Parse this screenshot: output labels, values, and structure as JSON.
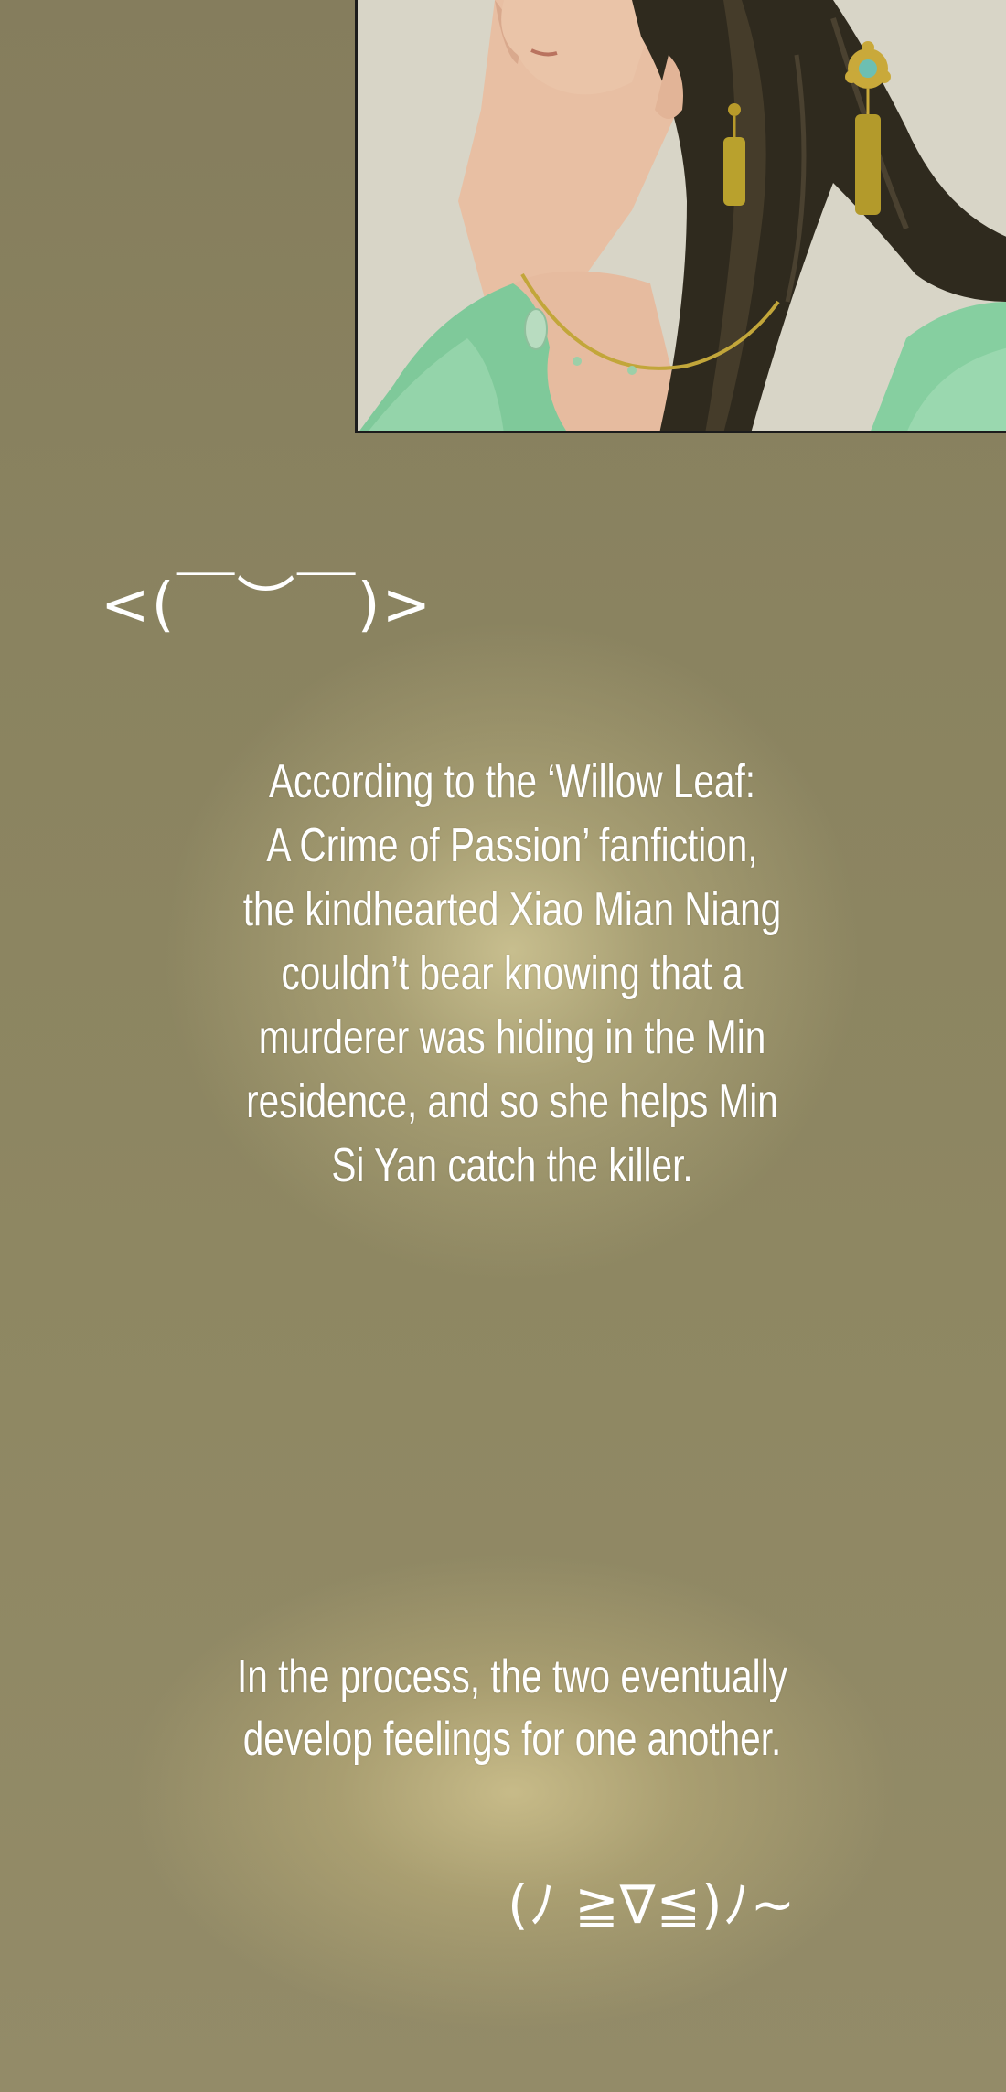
{
  "panel": {
    "image": "illustration of a woman with dark hair and gold tassel hair ornament wearing green robe"
  },
  "kaomoji_top": "<(￣︶￣)>",
  "narration_1": "According to the ‘Willow Leaf:\nA Crime of Passion’ fanfiction,\nthe kindhearted Xiao Mian Niang\ncouldn’t bear knowing that a\nmurderer was hiding in the Min\nresidence, and so she helps Min\nSi Yan catch the killer.",
  "narration_2": "In the process, the two eventually\ndevelop feelings for one another.",
  "kaomoji_bottom": "(ﾉ ≧∇≦)ﾉ~",
  "colors": {
    "background": "#8c8562",
    "text": "#ffffff",
    "panel_border": "#1c1c1c"
  }
}
